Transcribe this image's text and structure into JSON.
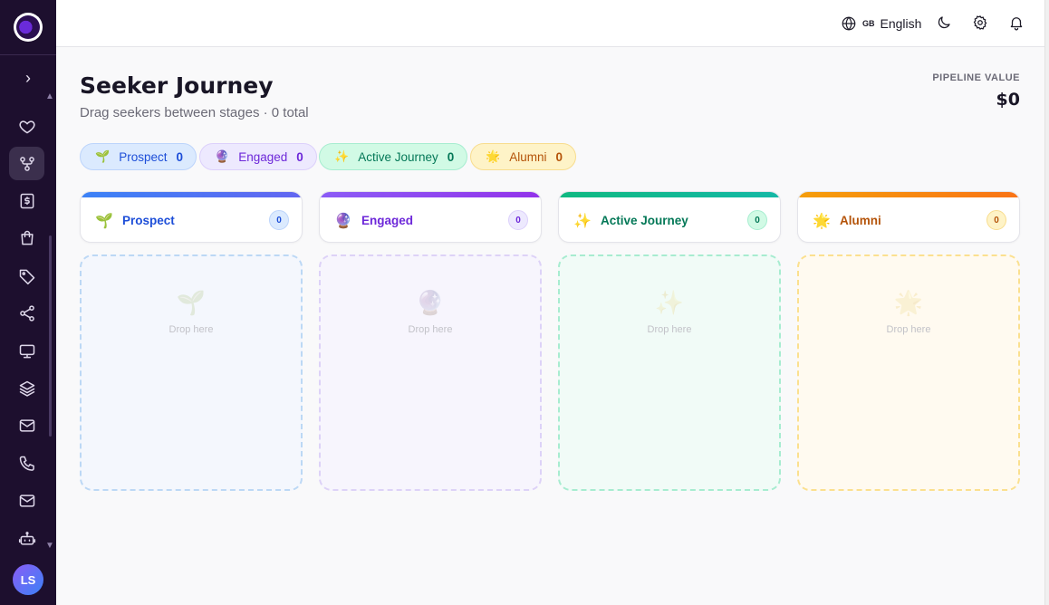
{
  "sidebar": {
    "toggle": "›",
    "items": [
      {
        "icon": "heart-icon"
      },
      {
        "icon": "pipeline-icon",
        "active": true
      },
      {
        "icon": "dollar-doc-icon"
      },
      {
        "icon": "shopping-bag-icon"
      },
      {
        "icon": "tag-icon"
      },
      {
        "icon": "share-icon"
      },
      {
        "icon": "monitor-icon"
      },
      {
        "icon": "layers-icon"
      },
      {
        "icon": "mail-icon"
      },
      {
        "icon": "phone-icon"
      },
      {
        "icon": "mail-icon"
      },
      {
        "icon": "bot-icon"
      }
    ],
    "avatar_initials": "LS"
  },
  "topbar": {
    "language_flag": "GB",
    "language_label": "English",
    "icons": [
      "globe-icon",
      "moon-icon",
      "gear-icon",
      "bell-icon"
    ]
  },
  "header": {
    "title": "Seeker Journey",
    "subtitle": "Drag seekers between stages · 0 total",
    "pipeline_label": "PIPELINE VALUE",
    "pipeline_value": "$0"
  },
  "stages": [
    {
      "label": "Prospect",
      "count": "0",
      "emoji": "🌱",
      "accent": "#3b82f6",
      "accent2": "#6366f1",
      "text": "#1d4ed8",
      "pill_bg": "#dbeafe",
      "pill_border": "#bcd4fb",
      "drop_bg": "#f4f7fd",
      "drop_border": "#bcd8f5"
    },
    {
      "label": "Engaged",
      "count": "0",
      "emoji": "🔮",
      "accent": "#8b5cf6",
      "accent2": "#9333ea",
      "text": "#6d28d9",
      "pill_bg": "#ede9fe",
      "pill_border": "#dcd0fb",
      "drop_bg": "#f7f5fd",
      "drop_border": "#ddd2f7"
    },
    {
      "label": "Active Journey",
      "count": "0",
      "emoji": "✨",
      "accent": "#10b981",
      "accent2": "#14b8a6",
      "text": "#047857",
      "pill_bg": "#d1fae5",
      "pill_border": "#a7edd0",
      "drop_bg": "#f1fbf7",
      "drop_border": "#a7ecd0"
    },
    {
      "label": "Alumni",
      "count": "0",
      "emoji": "🌟",
      "accent": "#f59e0b",
      "accent2": "#f97316",
      "text": "#b45309",
      "pill_bg": "#fef3c7",
      "pill_border": "#f8dd8e",
      "drop_bg": "#fffaf0",
      "drop_border": "#fbe08f"
    }
  ],
  "drop_text": "Drop here"
}
